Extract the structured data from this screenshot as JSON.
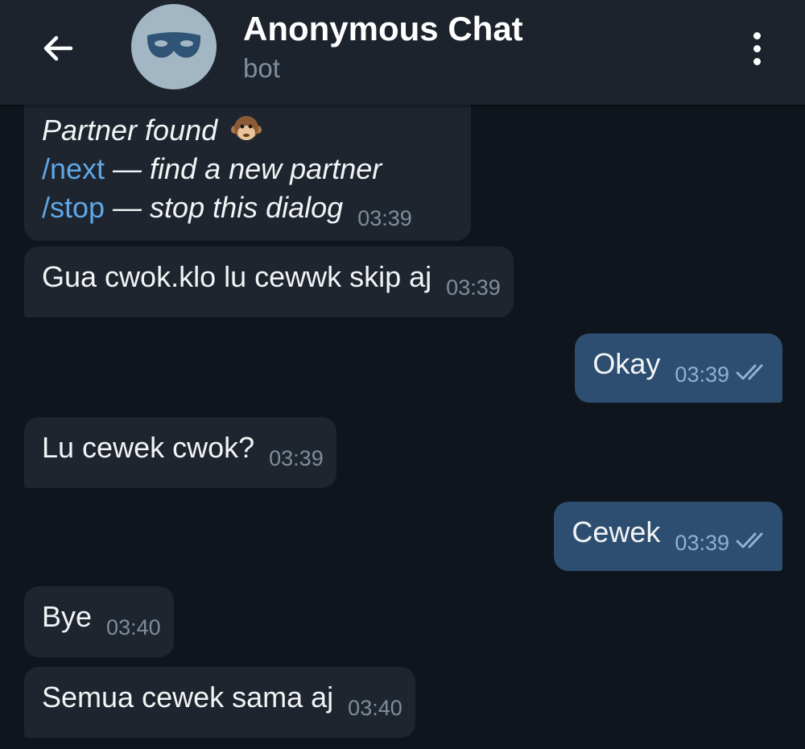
{
  "header": {
    "title": "Anonymous Chat",
    "subtitle": "bot",
    "back_icon": "arrow-left-icon",
    "avatar_icon": "mask-icon",
    "menu_icon": "more-vertical-icon"
  },
  "messages": [
    {
      "direction": "incoming",
      "lines": [
        {
          "text": "Partner found",
          "emoji": "monkey-face"
        },
        {
          "command": "/next",
          "text": " — find a new partner"
        },
        {
          "command": "/stop",
          "text": " — stop this dialog"
        }
      ],
      "time": "03:39"
    },
    {
      "direction": "incoming",
      "text": "Gua cwok.klo lu cewwk skip aj",
      "time": "03:39"
    },
    {
      "direction": "outgoing",
      "text": "Okay",
      "time": "03:39",
      "status": "read"
    },
    {
      "direction": "incoming",
      "text": "Lu cewek cwok?",
      "time": "03:39"
    },
    {
      "direction": "outgoing",
      "text": "Cewek",
      "time": "03:39",
      "status": "read"
    },
    {
      "direction": "incoming",
      "text": "Bye",
      "time": "03:40"
    },
    {
      "direction": "incoming",
      "text": "Semua cewek sama aj",
      "time": "03:40"
    }
  ],
  "colors": {
    "background": "#0f151c",
    "header": "#1c232c",
    "incoming_bubble": "#1f252e",
    "outgoing_bubble": "#2d4e70",
    "command_link": "#5ea7e8",
    "timestamp": "#7e8d9a"
  }
}
